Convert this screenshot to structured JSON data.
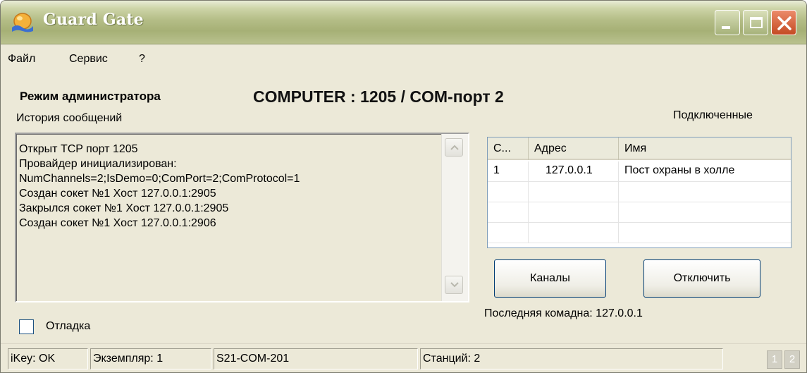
{
  "window": {
    "title": "Guard Gate"
  },
  "menu": {
    "items": [
      "Файл",
      "Сервис",
      "?"
    ]
  },
  "header": {
    "mode": "Режим администратора",
    "computer": "COMPUTER : 1205 / COM-порт 2"
  },
  "history": {
    "label": "История сообщений",
    "lines": [
      "Открыт TCP порт 1205",
      "Провайдер инициализирован:",
      "NumChannels=2;IsDemo=0;ComPort=2;ComProtocol=1",
      "Создан сокет №1 Хост 127.0.0.1:2905",
      "Закрылся сокет №1 Хост 127.0.0.1:2905",
      "Создан сокет №1 Хост 127.0.0.1:2906"
    ]
  },
  "connected": {
    "label": "Подключенные",
    "columns": [
      "С...",
      "Адрес",
      "Имя"
    ],
    "rows": [
      [
        "1",
        "127.0.0.1",
        "Пост охраны в холле"
      ]
    ]
  },
  "buttons": {
    "channels": "Каналы",
    "disconnect": "Отключить"
  },
  "debug": {
    "label": "Отладка",
    "checked": false
  },
  "last_command": "Последняя комадна: 127.0.0.1",
  "statusbar": {
    "ikey": "iKey: OK",
    "instance": "Экземпляр: 1",
    "serial": "S21-COM-201",
    "stations": "Станций: 2",
    "indicators": [
      "1",
      "2"
    ]
  },
  "colors": {
    "titlebar": "#b4bd86",
    "window_bg": "#ece9d8",
    "close_button": "#c44a23",
    "list_border": "#7f9db9"
  }
}
